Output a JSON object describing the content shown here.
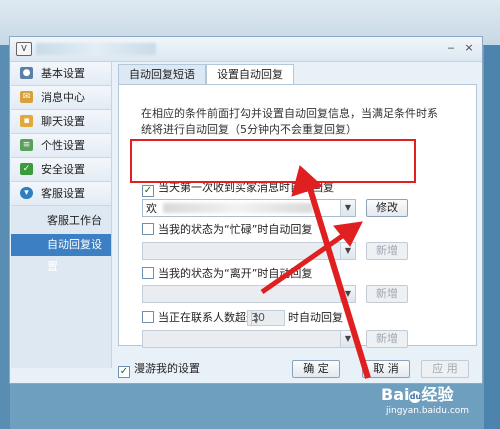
{
  "window": {
    "close_glyph": "×",
    "min_glyph": "‒",
    "app_icon_text": "V"
  },
  "sidebar": {
    "items": [
      {
        "label": "基本设置",
        "icon": "user-icon",
        "color": "#5b7fa8"
      },
      {
        "label": "消息中心",
        "icon": "envelope-icon",
        "color": "#d8a13a"
      },
      {
        "label": "聊天设置",
        "icon": "chat-bubble-icon",
        "color": "#e3a83a"
      },
      {
        "label": "个性设置",
        "icon": "document-icon",
        "color": "#5aa05a"
      },
      {
        "label": "安全设置",
        "icon": "shield-icon",
        "color": "#3b9a3b"
      },
      {
        "label": "客服设置",
        "icon": "headset-icon",
        "color": "#2f7fc0"
      }
    ],
    "sub_items": [
      {
        "label": "客服工作台",
        "active": false
      },
      {
        "label": "自动回复设置",
        "active": true
      }
    ]
  },
  "tabs": [
    {
      "label": "自动回复短语",
      "active": false
    },
    {
      "label": "设置自动回复",
      "active": true
    }
  ],
  "panel": {
    "description": "在相应的条件前面打勾并设置自动回复信息，当满足条件时系统将进行自动回复（5分钟内不会重复回复）",
    "options": [
      {
        "label": "当天第一次收到买家消息时自动回复",
        "checked": true,
        "value": "欢",
        "button": "修改",
        "enabled": true
      },
      {
        "label": "当我的状态为“忙碌”时自动回复",
        "checked": false,
        "value": "",
        "button": "新增",
        "enabled": false
      },
      {
        "label": "当我的状态为“离开”时自动回复",
        "checked": false,
        "value": "",
        "button": "新增",
        "enabled": false
      },
      {
        "label_before": "当正在联系人数超过",
        "spin_value": "30",
        "label_after": "时自动回复",
        "checked": false,
        "value": "",
        "button": "新增",
        "enabled": false
      }
    ]
  },
  "footer": {
    "roam_label": "漫游我的设置",
    "roam_checked": true,
    "ok": "确 定",
    "cancel": "取 消",
    "apply": "应 用"
  },
  "watermark": {
    "logo_a": "Bai",
    "logo_paw": "du",
    "logo_b": "经验",
    "url": "jingyan.baidu.com"
  },
  "colors": {
    "highlight": "#e02020",
    "active_nav": "#3c7fc3"
  }
}
